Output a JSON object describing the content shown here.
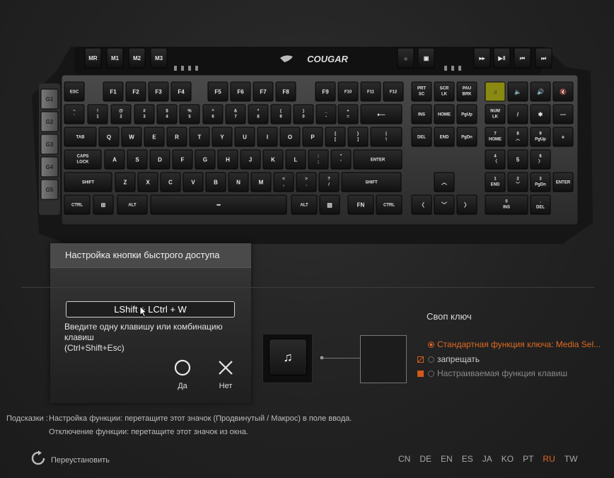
{
  "keyboard": {
    "brand": "COUGAR",
    "macro_keys": [
      "MR",
      "M1",
      "M2",
      "M3"
    ],
    "side_keys": [
      "G1",
      "G2",
      "G3",
      "G4",
      "G5"
    ],
    "top_right_icons": [
      "brightness-icon",
      "lock-icon",
      "rewind-icon",
      "play-pause-icon",
      "prev-icon",
      "next-icon"
    ],
    "rows": [
      [
        "ESC",
        "F1",
        "F2",
        "F3",
        "F4",
        "F5",
        "F6",
        "F7",
        "F8",
        "F9",
        "F10",
        "F11",
        "F12",
        "PRT SC",
        "SCR LK",
        "PAU BRK"
      ],
      [
        "~ `",
        "! 1",
        "@ 2",
        "# 3",
        "$ 4",
        "% 5",
        "^ 6",
        "& 7",
        "* 8",
        "( 9",
        ") 0",
        "_ -",
        "+ =",
        "⟵",
        "INS",
        "HOME",
        "PgUp",
        "NUM LK",
        "/",
        "✱",
        "—"
      ],
      [
        "TAB",
        "Q",
        "W",
        "E",
        "R",
        "T",
        "Y",
        "U",
        "I",
        "O",
        "P",
        "{ [",
        "} ]",
        "| \\",
        "DEL",
        "END",
        "PgDn",
        "7 HOME",
        "8 ︿",
        "9 PgUp",
        "+"
      ],
      [
        "CAPS LOCK",
        "A",
        "S",
        "D",
        "F",
        "G",
        "H",
        "J",
        "K",
        "L",
        ": ;",
        "\" '",
        "ENTER",
        "4 〈",
        "5",
        "6 〉"
      ],
      [
        "SHIFT",
        "Z",
        "X",
        "C",
        "V",
        "B",
        "N",
        "M",
        "< ,",
        "> .",
        "? /",
        "SHIFT",
        "︿",
        "1 END",
        "2 ﹀",
        "3 PgDn",
        "ENTER"
      ],
      [
        "CTRL",
        "⊞",
        "ALT",
        "━",
        "ALT",
        "▤",
        "FN",
        "CTRL",
        "〈",
        "﹀",
        "〉",
        "0 INS",
        ". DEL"
      ]
    ],
    "media_keys": [
      "♫",
      "🔈",
      "🔊",
      "🔇"
    ]
  },
  "dialog": {
    "title": "Настройка кнопки быстрого доступа",
    "input_value": "LShift + LCtrl + W",
    "hint": "Введите одну клавишу или комбинацию клавиш\n(Ctrl+Shift+Esc)",
    "yes_label": "Да",
    "no_label": "Нет"
  },
  "swap": {
    "title": "Своп ключ",
    "key_icon": "♫",
    "options": [
      {
        "label": "Стандартная функция ключа: Media Sel...",
        "selected": true,
        "marker_color": "#d05a1a"
      },
      {
        "label": "запрещать",
        "selected": false,
        "marker_color": "#d05a1a"
      },
      {
        "label": "Настраиваемая функция клавиш",
        "selected": false,
        "marker_color": "#d05a1a"
      }
    ]
  },
  "tips": {
    "label": "Подсказки :",
    "line1": "Настройка функции: перетащите этот значок (Продвинутый / Макрос) в поле ввода.",
    "line2": "Отключение функции: перетащите этот значок из окна."
  },
  "reset_label": "Переустановить",
  "languages": [
    "CN",
    "DE",
    "EN",
    "ES",
    "JA",
    "KO",
    "PT",
    "RU",
    "TW"
  ],
  "active_language": "RU",
  "colors": {
    "accent": "#e06a22",
    "highlight_key": "#8a8a12"
  }
}
